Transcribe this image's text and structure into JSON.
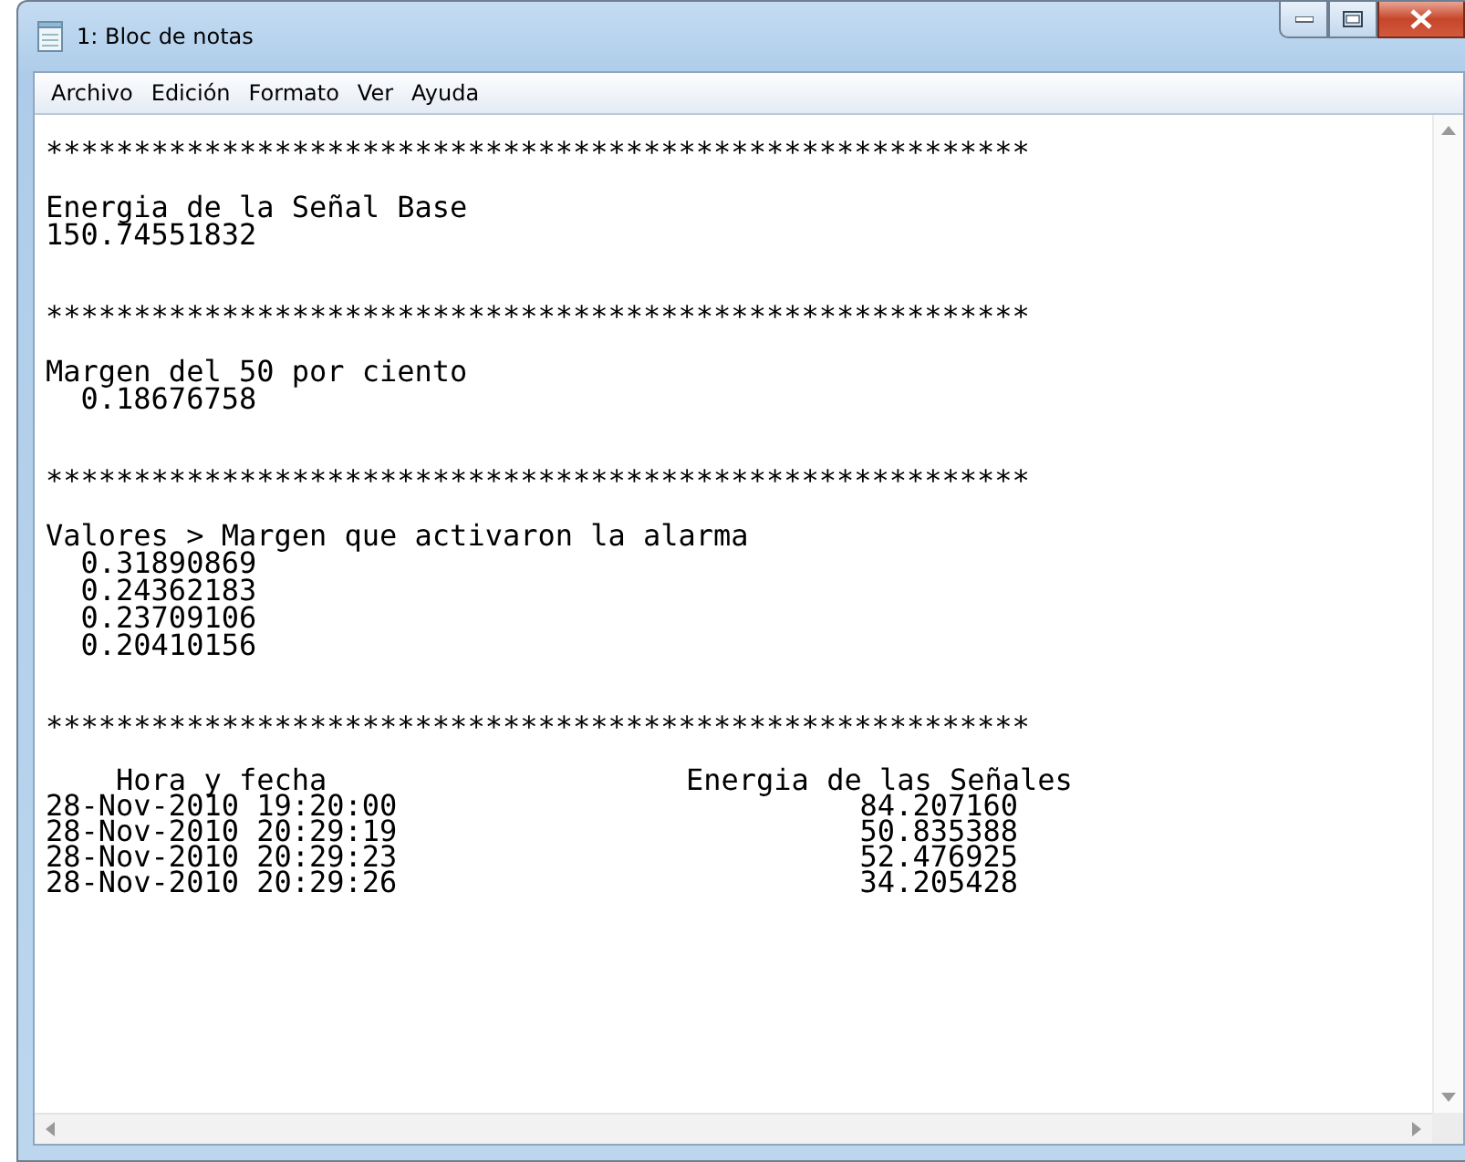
{
  "window": {
    "title": "1: Bloc de notas"
  },
  "menu": [
    "Archivo",
    "Edición",
    "Formato",
    "Ver",
    "Ayuda"
  ],
  "document": {
    "lines": [
      {
        "kind": "text",
        "text": "********************************************************"
      },
      {
        "kind": "blank"
      },
      {
        "kind": "text",
        "text": "Energia de la Señal Base"
      },
      {
        "kind": "text",
        "text": "150.74551832"
      },
      {
        "kind": "blank"
      },
      {
        "kind": "blank"
      },
      {
        "kind": "text",
        "text": "********************************************************"
      },
      {
        "kind": "blank"
      },
      {
        "kind": "text",
        "text": "Margen del 50 por ciento"
      },
      {
        "kind": "text",
        "text": "  0.18676758"
      },
      {
        "kind": "blank"
      },
      {
        "kind": "blank"
      },
      {
        "kind": "text",
        "text": "********************************************************"
      },
      {
        "kind": "blank"
      },
      {
        "kind": "text",
        "text": "Valores > Margen que activaron la alarma"
      },
      {
        "kind": "text",
        "text": "  0.31890869"
      },
      {
        "kind": "text",
        "text": "  0.24362183"
      },
      {
        "kind": "text",
        "text": "  0.23709106"
      },
      {
        "kind": "text",
        "text": "  0.20410156"
      },
      {
        "kind": "blank"
      },
      {
        "kind": "blank"
      },
      {
        "kind": "text",
        "text": "********************************************************"
      },
      {
        "kind": "blank"
      },
      {
        "kind": "header",
        "cells": [
          "    Hora y fecha",
          "Energia de las Señales"
        ]
      },
      {
        "kind": "row",
        "cells": [
          "28-Nov-2010 19:20:00",
          "84.207160"
        ]
      },
      {
        "kind": "row",
        "cells": [
          "28-Nov-2010 20:29:19",
          "50.835388"
        ]
      },
      {
        "kind": "row",
        "cells": [
          "28-Nov-2010 20:29:23",
          "52.476925"
        ]
      },
      {
        "kind": "row",
        "cells": [
          "28-Nov-2010 20:29:26",
          "34.205428"
        ]
      }
    ]
  }
}
